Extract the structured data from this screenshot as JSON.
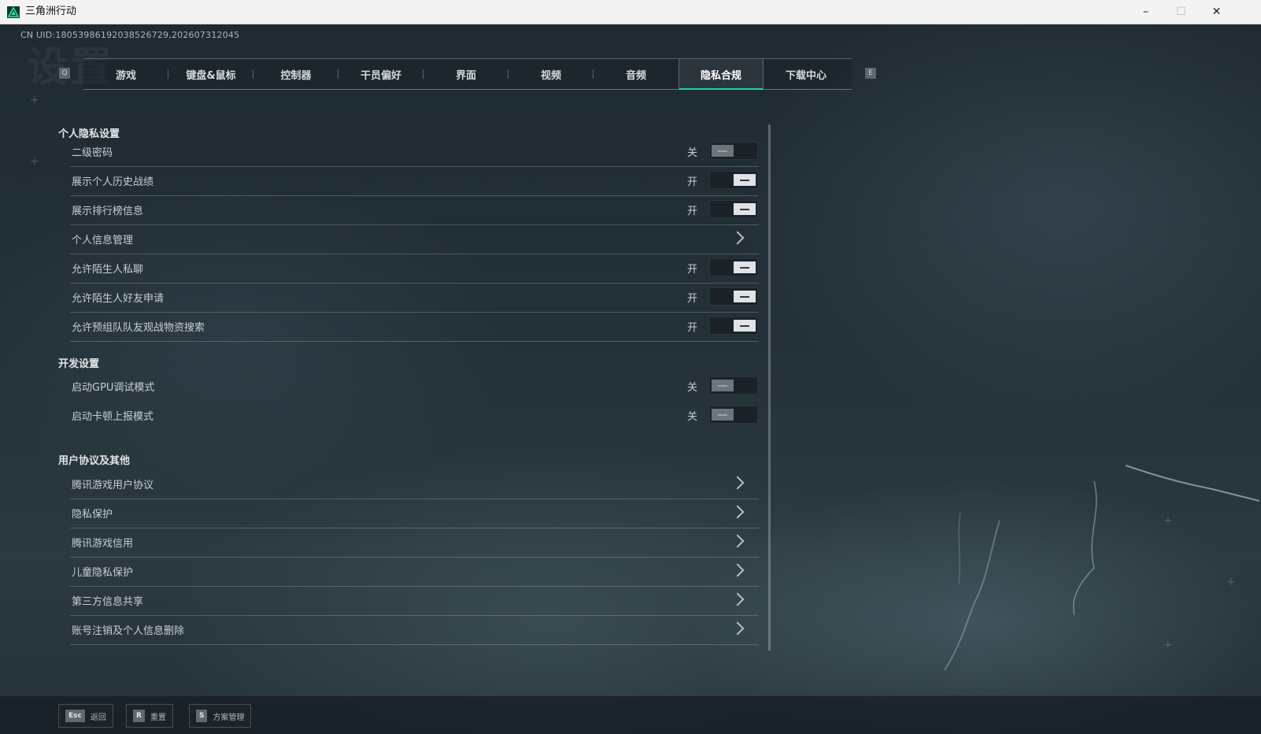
{
  "window": {
    "title": "三角洲行动",
    "minimize": "–",
    "maximize": "☐",
    "close": "✕"
  },
  "uid": "CN UID:1805398619203852672​9,202607312045",
  "page_watermark": "设置",
  "tabs": {
    "prev_key": "Q",
    "next_key": "E",
    "items": [
      {
        "label": "游戏"
      },
      {
        "label": "键盘&鼠标"
      },
      {
        "label": "控制器"
      },
      {
        "label": "干员偏好"
      },
      {
        "label": "界面"
      },
      {
        "label": "视频"
      },
      {
        "label": "音频"
      },
      {
        "label": "隐私合规",
        "active": true
      },
      {
        "label": "下载中心"
      }
    ]
  },
  "sections": {
    "privacy": {
      "title": "个人隐私设置",
      "rows": [
        {
          "label": "二级密码",
          "type": "toggle",
          "state": "关",
          "on": false
        },
        {
          "label": "展示个人历史战绩",
          "type": "toggle",
          "state": "开",
          "on": true
        },
        {
          "label": "展示排行榜信息",
          "type": "toggle",
          "state": "开",
          "on": true
        },
        {
          "label": "个人信息管理",
          "type": "link"
        },
        {
          "label": "允许陌生人私聊",
          "type": "toggle",
          "state": "开",
          "on": true
        },
        {
          "label": "允许陌生人好友申请",
          "type": "toggle",
          "state": "开",
          "on": true
        },
        {
          "label": "允许预组队队友观战物资搜索",
          "type": "toggle",
          "state": "开",
          "on": true
        }
      ]
    },
    "dev": {
      "title": "开发设置",
      "rows": [
        {
          "label": "启动GPU调试模式",
          "type": "toggle",
          "state": "关",
          "on": false
        },
        {
          "label": "启动卡顿上报模式",
          "type": "toggle",
          "state": "关",
          "on": false
        }
      ]
    },
    "agreements": {
      "title": "用户协议及其他",
      "rows": [
        {
          "label": "腾讯游戏用户协议",
          "type": "link"
        },
        {
          "label": "隐私保护",
          "type": "link"
        },
        {
          "label": "腾讯游戏信用",
          "type": "link"
        },
        {
          "label": "儿童隐私保护",
          "type": "link"
        },
        {
          "label": "第三方信息共享",
          "type": "link"
        },
        {
          "label": "账号注销及个人信息删除",
          "type": "link"
        }
      ]
    }
  },
  "bottom_bar": {
    "back": {
      "key": "Esc",
      "label": "返回"
    },
    "reset": {
      "key": "R",
      "label": "重置"
    },
    "plan": {
      "key": "S",
      "label": "方案管理"
    }
  },
  "colors": {
    "accent": "#1fd39c",
    "toggle_on_knob": "#dfe3e5",
    "toggle_off_knob": "#6b757b"
  }
}
